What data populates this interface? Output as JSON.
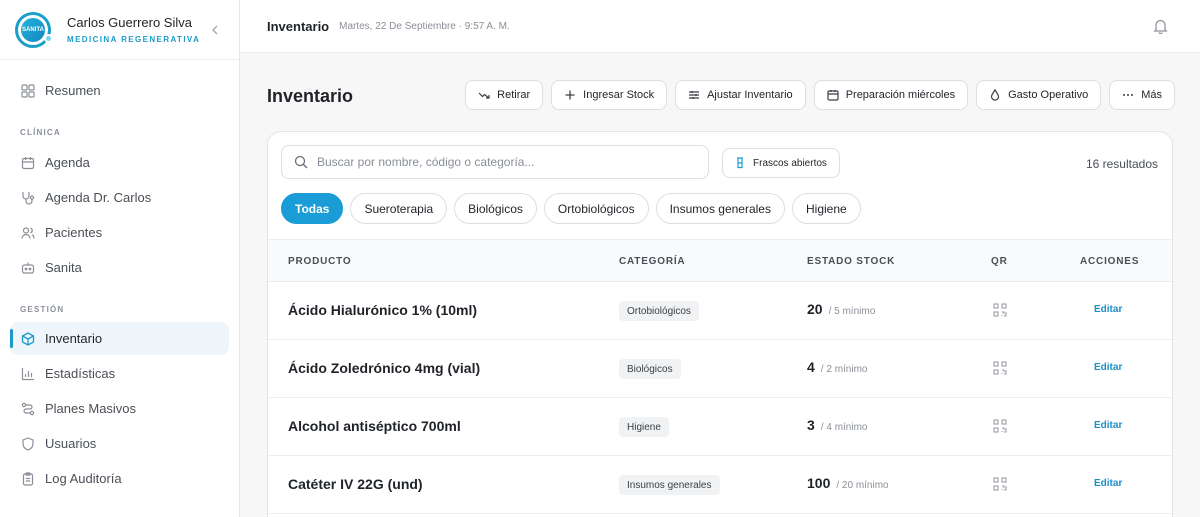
{
  "profile": {
    "logo_text": "SANITA",
    "name": "Carlos Guerrero Silva",
    "role": "MEDICINA REGENERATIVA"
  },
  "sidebar": {
    "top_item": {
      "label": "Resumen",
      "icon": "grid-icon"
    },
    "sections": [
      {
        "label": "CLÍNICA",
        "items": [
          {
            "label": "Agenda",
            "icon": "calendar-icon"
          },
          {
            "label": "Agenda Dr. Carlos",
            "icon": "stethoscope-icon"
          },
          {
            "label": "Pacientes",
            "icon": "users-icon"
          },
          {
            "label": "Sanita",
            "icon": "bot-icon"
          }
        ]
      },
      {
        "label": "GESTIÓN",
        "items": [
          {
            "label": "Inventario",
            "icon": "box-icon",
            "active": true
          },
          {
            "label": "Estadísticas",
            "icon": "bar-chart-icon"
          },
          {
            "label": "Planes Masivos",
            "icon": "route-icon"
          },
          {
            "label": "Usuarios",
            "icon": "shield-icon"
          },
          {
            "label": "Log Auditoría",
            "icon": "clipboard-icon"
          }
        ]
      }
    ]
  },
  "topbar": {
    "title": "Inventario",
    "date": "Martes, 22 De Septiembre · 9:57 A. M."
  },
  "header": {
    "title": "Inventario",
    "actions": [
      {
        "label": "Retirar",
        "icon": "trend-down-icon"
      },
      {
        "label": "Ingresar Stock",
        "icon": "plus-icon"
      },
      {
        "label": "Ajustar Inventario",
        "icon": "sliders-icon"
      },
      {
        "label": "Preparación miércoles",
        "icon": "calendar-icon"
      },
      {
        "label": "Gasto Operativo",
        "icon": "droplet-icon"
      },
      {
        "label": "Más",
        "icon": "more-icon"
      }
    ]
  },
  "search": {
    "placeholder": "Buscar por nombre, código o categoría...",
    "value": ""
  },
  "filter_open_vials": "Frascos abiertos",
  "results": "16 resultados",
  "chips": [
    "Todas",
    "Sueroterapia",
    "Biológicos",
    "Ortobiológicos",
    "Insumos generales",
    "Higiene"
  ],
  "active_chip": "Todas",
  "table": {
    "headers": {
      "product": "PRODUCTO",
      "category": "CATEGORÍA",
      "stock": "ESTADO STOCK",
      "qr": "QR",
      "actions": "ACCIONES"
    },
    "rows": [
      {
        "product": "Ácido Hialurónico 1% (10ml)",
        "category": "Ortobiológicos",
        "stock": "20",
        "min": "/ 5 mínimo",
        "action": "Editar"
      },
      {
        "product": "Ácido Zoledrónico 4mg (vial)",
        "category": "Biológicos",
        "stock": "4",
        "min": "/ 2 mínimo",
        "action": "Editar"
      },
      {
        "product": "Alcohol antiséptico 700ml",
        "category": "Higiene",
        "stock": "3",
        "min": "/ 4 mínimo",
        "action": "Editar"
      },
      {
        "product": "Catéter IV 22G (und)",
        "category": "Insumos generales",
        "stock": "100",
        "min": "/ 20 mínimo",
        "action": "Editar"
      }
    ]
  },
  "colors": {
    "accent": "#1a9cd6",
    "link": "#1a8fc9"
  }
}
